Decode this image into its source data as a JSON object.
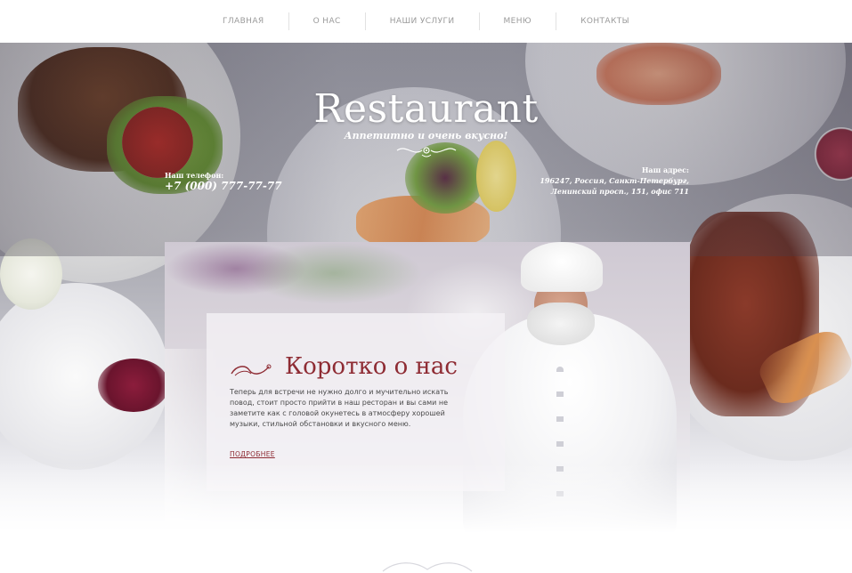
{
  "nav": {
    "items": [
      {
        "label": "ГЛАВНАЯ"
      },
      {
        "label": "О НАС"
      },
      {
        "label": "НАШИ УСЛУГИ"
      },
      {
        "label": "МЕНЮ"
      },
      {
        "label": "КОНТАКТЫ"
      }
    ]
  },
  "hero": {
    "brand": "Restaurant",
    "tagline": "Аппетитно и очень вкусно!",
    "phone_label": "Наш телефон:",
    "phone_number": "+7 (000) 777-77-77",
    "address_label": "Наш адрес:",
    "address_line1": "196247, Россия, Санкт-Петербург,",
    "address_line2": "Ленинский просп., 151, офис 711"
  },
  "about": {
    "title": "Коротко о нас",
    "text": "Теперь для встречи не нужно долго и мучительно искать повод, стоит просто прийти в наш ресторан и вы сами не заметите как с головой окунетесь в атмосферу хорошей музыки, стильной обстановки и вкусного меню.",
    "link_label": "ПОДРОБНЕЕ"
  },
  "colors": {
    "accent": "#8e2b33",
    "nav_text": "#9a9a9a",
    "hero_text": "#ffffff"
  },
  "icons": [
    "flourish-icon",
    "scroll-ornament-icon"
  ]
}
